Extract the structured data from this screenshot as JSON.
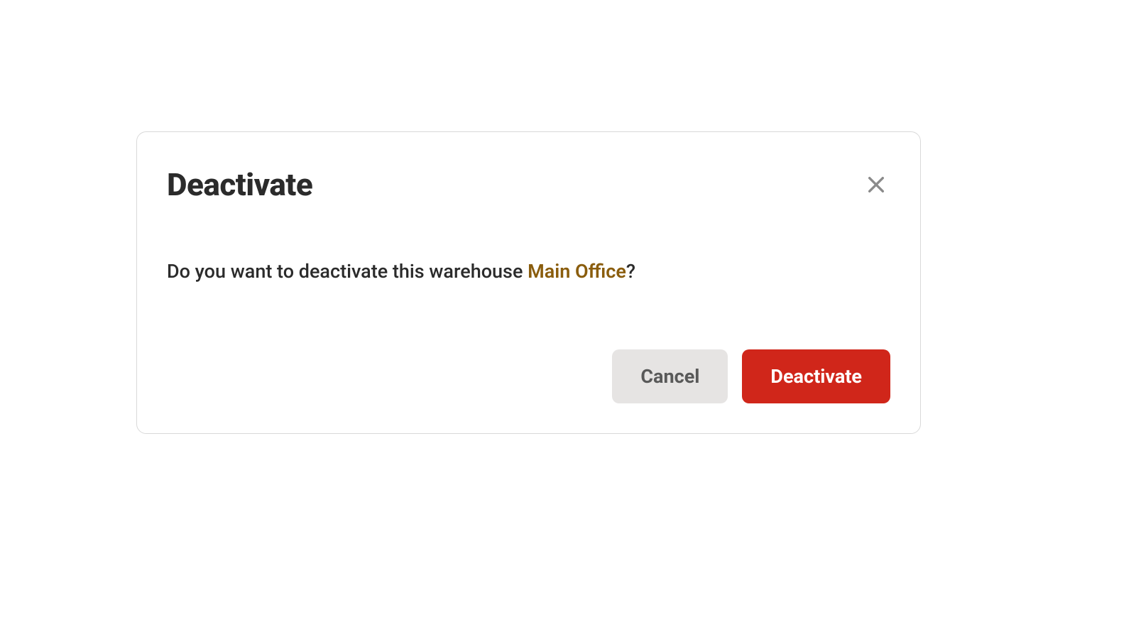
{
  "dialog": {
    "title": "Deactivate",
    "message_prefix": "Do you want to deactivate this warehouse ",
    "warehouse_name": "Main Office",
    "message_suffix": "?",
    "buttons": {
      "cancel": "Cancel",
      "confirm": "Deactivate"
    }
  }
}
